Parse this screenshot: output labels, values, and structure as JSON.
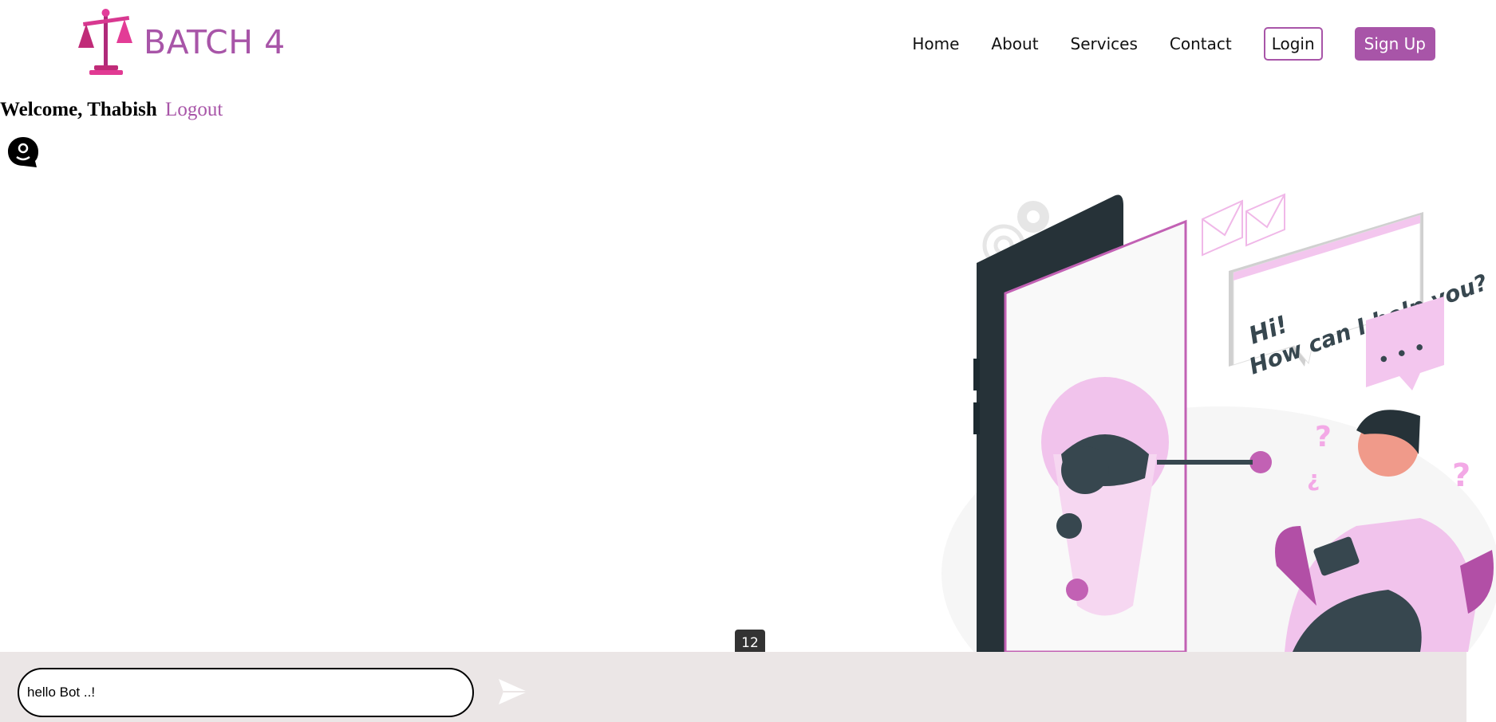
{
  "brand": {
    "name": "BATCH 4"
  },
  "nav": {
    "items": [
      "Home",
      "About",
      "Services",
      "Contact"
    ],
    "login": "Login",
    "signup": "Sign Up"
  },
  "user": {
    "welcome": "Welcome, Thabish",
    "logout": "Logout"
  },
  "illustration": {
    "bubble_line1": "Hi!",
    "bubble_line2": "How can I help you?",
    "dots": "• • •"
  },
  "chat": {
    "input_value": "hello Bot ..!",
    "counter": "12"
  },
  "icons": {
    "logo": "scales-of-justice-icon",
    "chat": "chatbot-icon",
    "send": "send-icon"
  },
  "colors": {
    "accent": "#a855a8",
    "input_bar": "#ebe6e6",
    "phone": "#263238",
    "robot": "#f1c3ec"
  }
}
